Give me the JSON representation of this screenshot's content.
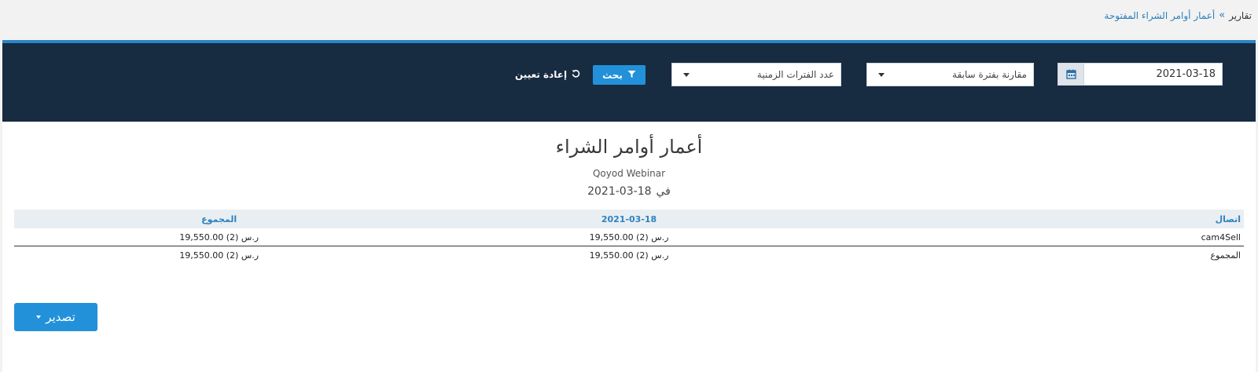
{
  "breadcrumb": {
    "root": "تقارير",
    "separator": "»",
    "current": "أعمار أوامر الشراء المفتوحة"
  },
  "filters": {
    "date_value": "2021-03-18",
    "compare_select": "مقارنة بفترة سابقة",
    "periods_select": "عدد الفترات الزمنية",
    "search_label": "بحث",
    "reset_label": "إعادة تعيين"
  },
  "report": {
    "title": "أعمار أوامر الشراء",
    "company": "Qoyod Webinar",
    "asof_prefix": "في",
    "asof_date": "18-03-2021",
    "headers": {
      "contact": "اتصال",
      "date": "2021-03-18",
      "total": "المجموع"
    },
    "rows": [
      {
        "contact": "cam4Sell",
        "date_amount": "19,550.00 ر.س (2)",
        "total_amount": "19,550.00 ر.س (2)"
      }
    ],
    "totals": {
      "label": "المجموع",
      "date_amount": "19,550.00 ر.س (2)",
      "total_amount": "19,550.00 ر.س (2)"
    }
  },
  "export_label": "تصدير",
  "colors": {
    "accent": "#2391d9",
    "header_bg": "#172b41",
    "link": "#2a7fb8"
  }
}
